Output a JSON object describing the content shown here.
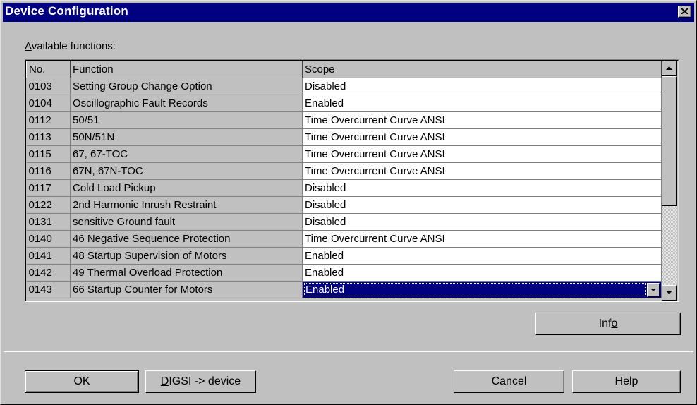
{
  "window": {
    "title": "Device Configuration",
    "close_icon": "close-icon"
  },
  "available_label": {
    "mnemonic": "A",
    "rest": "vailable functions:"
  },
  "table": {
    "headers": {
      "no": "No.",
      "function": "Function",
      "scope": "Scope"
    },
    "rows": [
      {
        "no": "0103",
        "function": "Setting Group Change Option",
        "scope": "Disabled"
      },
      {
        "no": "0104",
        "function": "Oscillographic Fault Records",
        "scope": "Enabled"
      },
      {
        "no": "0112",
        "function": "50/51",
        "scope": "Time Overcurrent Curve  ANSI"
      },
      {
        "no": "0113",
        "function": "50N/51N",
        "scope": "Time Overcurrent Curve  ANSI"
      },
      {
        "no": "0115",
        "function": "67, 67-TOC",
        "scope": "Time Overcurrent Curve  ANSI"
      },
      {
        "no": "0116",
        "function": "67N, 67N-TOC",
        "scope": "Time Overcurrent Curve  ANSI"
      },
      {
        "no": "0117",
        "function": "Cold Load Pickup",
        "scope": "Disabled"
      },
      {
        "no": "0122",
        "function": "2nd Harmonic Inrush Restraint",
        "scope": "Disabled"
      },
      {
        "no": "0131",
        "function": "sensitive Ground fault",
        "scope": "Disabled"
      },
      {
        "no": "0140",
        "function": "46 Negative Sequence  Protection",
        "scope": "Time Overcurrent Curve ANSI"
      },
      {
        "no": "0141",
        "function": "48 Startup Supervision of Motors",
        "scope": "Enabled"
      },
      {
        "no": "0142",
        "function": "49 Thermal Overload Protection",
        "scope": "Enabled"
      },
      {
        "no": "0143",
        "function": "66 Startup Counter for Motors",
        "scope": "Enabled",
        "selected": true
      }
    ]
  },
  "buttons": {
    "info": {
      "pre": "Inf",
      "mnemonic": "o",
      "post": ""
    },
    "ok": "OK",
    "digsi": {
      "mnemonic": "D",
      "rest": "IGSI -> device"
    },
    "cancel": "Cancel",
    "help": "Help"
  },
  "colors": {
    "titlebar": "#000080",
    "face": "#c0c0c0",
    "selection": "#000080"
  }
}
